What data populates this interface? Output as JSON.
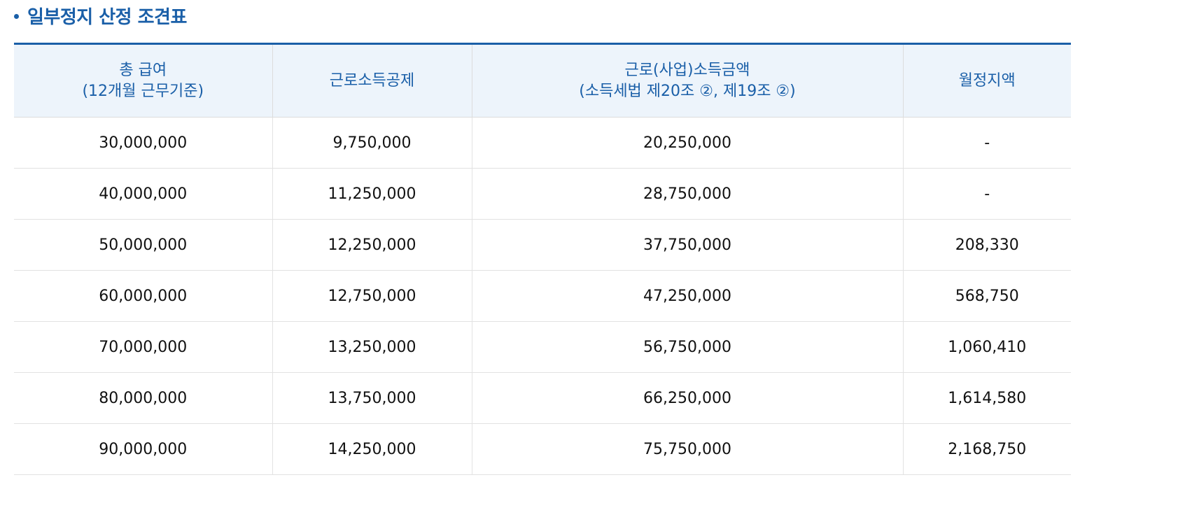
{
  "section": {
    "title": "일부정지 산정 조견표"
  },
  "table": {
    "headers": [
      {
        "line1": "총 급여",
        "line2": "(12개월 근무기준)"
      },
      {
        "line1": "근로소득공제",
        "line2": ""
      },
      {
        "line1": "근로(사업)소득금액",
        "line2": "(소득세법 제20조 ②, 제19조 ②)"
      },
      {
        "line1": "월정지액",
        "line2": ""
      }
    ],
    "rows": [
      [
        "30,000,000",
        "9,750,000",
        "20,250,000",
        "-"
      ],
      [
        "40,000,000",
        "11,250,000",
        "28,750,000",
        "-"
      ],
      [
        "50,000,000",
        "12,250,000",
        "37,750,000",
        "208,330"
      ],
      [
        "60,000,000",
        "12,750,000",
        "47,250,000",
        "568,750"
      ],
      [
        "70,000,000",
        "13,250,000",
        "56,750,000",
        "1,060,410"
      ],
      [
        "80,000,000",
        "13,750,000",
        "66,250,000",
        "1,614,580"
      ],
      [
        "90,000,000",
        "14,250,000",
        "75,750,000",
        "2,168,750"
      ]
    ]
  }
}
